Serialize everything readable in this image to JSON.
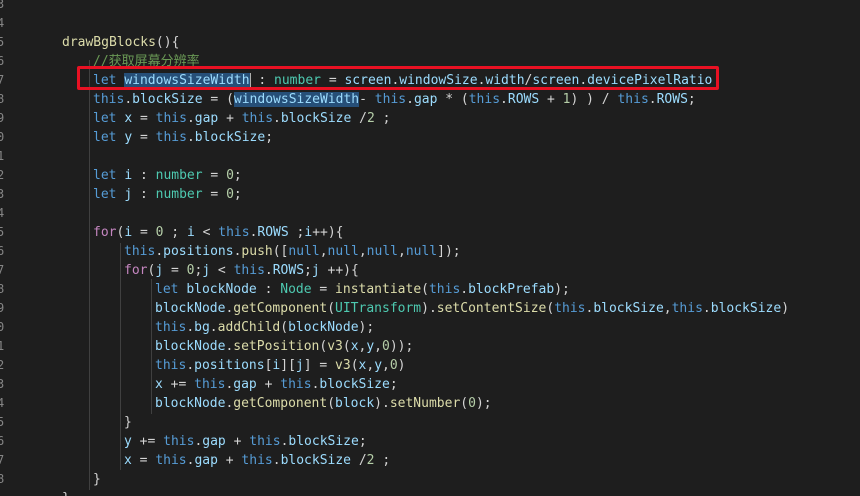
{
  "gutter": {
    "line_numbers": [
      "3",
      "4",
      "5",
      "6",
      "7",
      "8",
      "9",
      "0",
      "1",
      "2",
      "3",
      "4",
      "5",
      "6",
      "7",
      "8",
      "9",
      "0",
      "1",
      "2",
      "3",
      "4",
      "5",
      "6",
      "7",
      "8"
    ]
  },
  "code": {
    "lines": [
      [],
      [],
      [
        {
          "t": "drawBgBlocks",
          "c": "fn"
        },
        {
          "t": "(){",
          "c": "pl"
        }
      ],
      [
        {
          "t": "//获取屏幕分辨率",
          "c": "cm"
        }
      ],
      [
        {
          "t": "let ",
          "c": "kw"
        },
        {
          "t": "windowsSizeWidth",
          "c": "var",
          "sel": true
        },
        {
          "t": " : ",
          "c": "pl"
        },
        {
          "t": "number",
          "c": "type"
        },
        {
          "t": " = ",
          "c": "pl"
        },
        {
          "t": "screen",
          "c": "var"
        },
        {
          "t": ".",
          "c": "pl"
        },
        {
          "t": "windowSize",
          "c": "var"
        },
        {
          "t": ".",
          "c": "pl"
        },
        {
          "t": "width",
          "c": "var"
        },
        {
          "t": "/",
          "c": "pl"
        },
        {
          "t": "screen",
          "c": "var"
        },
        {
          "t": ".",
          "c": "pl"
        },
        {
          "t": "devicePixelRatio",
          "c": "var"
        }
      ],
      [
        {
          "t": "this",
          "c": "kw"
        },
        {
          "t": ".",
          "c": "pl"
        },
        {
          "t": "blockSize",
          "c": "var"
        },
        {
          "t": " = (",
          "c": "pl"
        },
        {
          "t": "windowsSizeWidth",
          "c": "var",
          "sel": true
        },
        {
          "t": "- ",
          "c": "pl"
        },
        {
          "t": "this",
          "c": "kw"
        },
        {
          "t": ".",
          "c": "pl"
        },
        {
          "t": "gap",
          "c": "var"
        },
        {
          "t": " * (",
          "c": "pl"
        },
        {
          "t": "this",
          "c": "kw"
        },
        {
          "t": ".",
          "c": "pl"
        },
        {
          "t": "ROWS",
          "c": "var"
        },
        {
          "t": " + ",
          "c": "pl"
        },
        {
          "t": "1",
          "c": "num"
        },
        {
          "t": ") ) / ",
          "c": "pl"
        },
        {
          "t": "this",
          "c": "kw"
        },
        {
          "t": ".",
          "c": "pl"
        },
        {
          "t": "ROWS",
          "c": "var"
        },
        {
          "t": ";",
          "c": "pl"
        }
      ],
      [
        {
          "t": "let ",
          "c": "kw"
        },
        {
          "t": "x",
          "c": "var"
        },
        {
          "t": " = ",
          "c": "pl"
        },
        {
          "t": "this",
          "c": "kw"
        },
        {
          "t": ".",
          "c": "pl"
        },
        {
          "t": "gap",
          "c": "var"
        },
        {
          "t": " + ",
          "c": "pl"
        },
        {
          "t": "this",
          "c": "kw"
        },
        {
          "t": ".",
          "c": "pl"
        },
        {
          "t": "blockSize",
          "c": "var"
        },
        {
          "t": " /",
          "c": "pl"
        },
        {
          "t": "2",
          "c": "num"
        },
        {
          "t": " ;",
          "c": "pl"
        }
      ],
      [
        {
          "t": "let ",
          "c": "kw"
        },
        {
          "t": "y",
          "c": "var"
        },
        {
          "t": " = ",
          "c": "pl"
        },
        {
          "t": "this",
          "c": "kw"
        },
        {
          "t": ".",
          "c": "pl"
        },
        {
          "t": "blockSize",
          "c": "var"
        },
        {
          "t": ";",
          "c": "pl"
        }
      ],
      [],
      [
        {
          "t": "let ",
          "c": "kw"
        },
        {
          "t": "i",
          "c": "var"
        },
        {
          "t": " : ",
          "c": "pl"
        },
        {
          "t": "number",
          "c": "type"
        },
        {
          "t": " = ",
          "c": "pl"
        },
        {
          "t": "0",
          "c": "num"
        },
        {
          "t": ";",
          "c": "pl"
        }
      ],
      [
        {
          "t": "let ",
          "c": "kw"
        },
        {
          "t": "j",
          "c": "var"
        },
        {
          "t": " : ",
          "c": "pl"
        },
        {
          "t": "number",
          "c": "type"
        },
        {
          "t": " = ",
          "c": "pl"
        },
        {
          "t": "0",
          "c": "num"
        },
        {
          "t": ";",
          "c": "pl"
        }
      ],
      [],
      [
        {
          "t": "for",
          "c": "ctl"
        },
        {
          "t": "(",
          "c": "pl"
        },
        {
          "t": "i",
          "c": "var"
        },
        {
          "t": " = ",
          "c": "pl"
        },
        {
          "t": "0",
          "c": "num"
        },
        {
          "t": " ; ",
          "c": "pl"
        },
        {
          "t": "i",
          "c": "var"
        },
        {
          "t": " < ",
          "c": "pl"
        },
        {
          "t": "this",
          "c": "kw"
        },
        {
          "t": ".",
          "c": "pl"
        },
        {
          "t": "ROWS",
          "c": "var"
        },
        {
          "t": " ;",
          "c": "pl"
        },
        {
          "t": "i",
          "c": "var"
        },
        {
          "t": "++){",
          "c": "pl"
        }
      ],
      [
        {
          "t": "this",
          "c": "kw"
        },
        {
          "t": ".",
          "c": "pl"
        },
        {
          "t": "positions",
          "c": "var"
        },
        {
          "t": ".",
          "c": "pl"
        },
        {
          "t": "push",
          "c": "fn"
        },
        {
          "t": "([",
          "c": "pl"
        },
        {
          "t": "null",
          "c": "kw"
        },
        {
          "t": ",",
          "c": "pl"
        },
        {
          "t": "null",
          "c": "kw"
        },
        {
          "t": ",",
          "c": "pl"
        },
        {
          "t": "null",
          "c": "kw"
        },
        {
          "t": ",",
          "c": "pl"
        },
        {
          "t": "null",
          "c": "kw"
        },
        {
          "t": "]);",
          "c": "pl"
        }
      ],
      [
        {
          "t": "for",
          "c": "ctl"
        },
        {
          "t": "(",
          "c": "pl"
        },
        {
          "t": "j",
          "c": "var"
        },
        {
          "t": " = ",
          "c": "pl"
        },
        {
          "t": "0",
          "c": "num"
        },
        {
          "t": ";",
          "c": "pl"
        },
        {
          "t": "j",
          "c": "var"
        },
        {
          "t": " < ",
          "c": "pl"
        },
        {
          "t": "this",
          "c": "kw"
        },
        {
          "t": ".",
          "c": "pl"
        },
        {
          "t": "ROWS",
          "c": "var"
        },
        {
          "t": ";",
          "c": "pl"
        },
        {
          "t": "j",
          "c": "var"
        },
        {
          "t": " ++){",
          "c": "pl"
        }
      ],
      [
        {
          "t": "let ",
          "c": "kw"
        },
        {
          "t": "blockNode",
          "c": "var"
        },
        {
          "t": " : ",
          "c": "pl"
        },
        {
          "t": "Node",
          "c": "type"
        },
        {
          "t": " = ",
          "c": "pl"
        },
        {
          "t": "instantiate",
          "c": "fn"
        },
        {
          "t": "(",
          "c": "pl"
        },
        {
          "t": "this",
          "c": "kw"
        },
        {
          "t": ".",
          "c": "pl"
        },
        {
          "t": "blockPrefab",
          "c": "var"
        },
        {
          "t": ");",
          "c": "pl"
        }
      ],
      [
        {
          "t": "blockNode",
          "c": "var"
        },
        {
          "t": ".",
          "c": "pl"
        },
        {
          "t": "getComponent",
          "c": "fn"
        },
        {
          "t": "(",
          "c": "pl"
        },
        {
          "t": "UITransform",
          "c": "type"
        },
        {
          "t": ").",
          "c": "pl"
        },
        {
          "t": "setContentSize",
          "c": "fn"
        },
        {
          "t": "(",
          "c": "pl"
        },
        {
          "t": "this",
          "c": "kw"
        },
        {
          "t": ".",
          "c": "pl"
        },
        {
          "t": "blockSize",
          "c": "var"
        },
        {
          "t": ",",
          "c": "pl"
        },
        {
          "t": "this",
          "c": "kw"
        },
        {
          "t": ".",
          "c": "pl"
        },
        {
          "t": "blockSize",
          "c": "var"
        },
        {
          "t": ")",
          "c": "pl"
        }
      ],
      [
        {
          "t": "this",
          "c": "kw"
        },
        {
          "t": ".",
          "c": "pl"
        },
        {
          "t": "bg",
          "c": "var"
        },
        {
          "t": ".",
          "c": "pl"
        },
        {
          "t": "addChild",
          "c": "fn"
        },
        {
          "t": "(",
          "c": "pl"
        },
        {
          "t": "blockNode",
          "c": "var"
        },
        {
          "t": ");",
          "c": "pl"
        }
      ],
      [
        {
          "t": "blockNode",
          "c": "var"
        },
        {
          "t": ".",
          "c": "pl"
        },
        {
          "t": "setPosition",
          "c": "fn"
        },
        {
          "t": "(",
          "c": "pl"
        },
        {
          "t": "v3",
          "c": "fn"
        },
        {
          "t": "(",
          "c": "pl"
        },
        {
          "t": "x",
          "c": "var"
        },
        {
          "t": ",",
          "c": "pl"
        },
        {
          "t": "y",
          "c": "var"
        },
        {
          "t": ",",
          "c": "pl"
        },
        {
          "t": "0",
          "c": "num"
        },
        {
          "t": "));",
          "c": "pl"
        }
      ],
      [
        {
          "t": "this",
          "c": "kw"
        },
        {
          "t": ".",
          "c": "pl"
        },
        {
          "t": "positions",
          "c": "var"
        },
        {
          "t": "[",
          "c": "pl"
        },
        {
          "t": "i",
          "c": "var"
        },
        {
          "t": "][",
          "c": "pl"
        },
        {
          "t": "j",
          "c": "var"
        },
        {
          "t": "] = ",
          "c": "pl"
        },
        {
          "t": "v3",
          "c": "fn"
        },
        {
          "t": "(",
          "c": "pl"
        },
        {
          "t": "x",
          "c": "var"
        },
        {
          "t": ",",
          "c": "pl"
        },
        {
          "t": "y",
          "c": "var"
        },
        {
          "t": ",",
          "c": "pl"
        },
        {
          "t": "0",
          "c": "num"
        },
        {
          "t": ")",
          "c": "pl"
        }
      ],
      [
        {
          "t": "x",
          "c": "var"
        },
        {
          "t": " += ",
          "c": "pl"
        },
        {
          "t": "this",
          "c": "kw"
        },
        {
          "t": ".",
          "c": "pl"
        },
        {
          "t": "gap",
          "c": "var"
        },
        {
          "t": " + ",
          "c": "pl"
        },
        {
          "t": "this",
          "c": "kw"
        },
        {
          "t": ".",
          "c": "pl"
        },
        {
          "t": "blockSize",
          "c": "var"
        },
        {
          "t": ";",
          "c": "pl"
        }
      ],
      [
        {
          "t": "blockNode",
          "c": "var"
        },
        {
          "t": ".",
          "c": "pl"
        },
        {
          "t": "getComponent",
          "c": "fn"
        },
        {
          "t": "(",
          "c": "pl"
        },
        {
          "t": "block",
          "c": "var"
        },
        {
          "t": ").",
          "c": "pl"
        },
        {
          "t": "setNumber",
          "c": "fn"
        },
        {
          "t": "(",
          "c": "pl"
        },
        {
          "t": "0",
          "c": "num"
        },
        {
          "t": ");",
          "c": "pl"
        }
      ],
      [
        {
          "t": "}",
          "c": "pl"
        }
      ],
      [
        {
          "t": "y",
          "c": "var"
        },
        {
          "t": " += ",
          "c": "pl"
        },
        {
          "t": "this",
          "c": "kw"
        },
        {
          "t": ".",
          "c": "pl"
        },
        {
          "t": "gap",
          "c": "var"
        },
        {
          "t": " + ",
          "c": "pl"
        },
        {
          "t": "this",
          "c": "kw"
        },
        {
          "t": ".",
          "c": "pl"
        },
        {
          "t": "blockSize",
          "c": "var"
        },
        {
          "t": ";",
          "c": "pl"
        }
      ],
      [
        {
          "t": "x",
          "c": "var"
        },
        {
          "t": " = ",
          "c": "pl"
        },
        {
          "t": "this",
          "c": "kw"
        },
        {
          "t": ".",
          "c": "pl"
        },
        {
          "t": "gap",
          "c": "var"
        },
        {
          "t": " + ",
          "c": "pl"
        },
        {
          "t": "this",
          "c": "kw"
        },
        {
          "t": ".",
          "c": "pl"
        },
        {
          "t": "blockSize",
          "c": "var"
        },
        {
          "t": " /",
          "c": "pl"
        },
        {
          "t": "2",
          "c": "num"
        },
        {
          "t": " ;",
          "c": "pl"
        }
      ],
      [
        {
          "t": "}",
          "c": "pl"
        }
      ]
    ],
    "last_line": [
      {
        "t": "}",
        "c": "pl"
      }
    ]
  },
  "colors": {
    "background": "#1e1e1e",
    "keyword": "#569cd6",
    "control": "#c586c0",
    "function": "#dcdcaa",
    "variable": "#9cdcfe",
    "number": "#b5cea8",
    "type": "#4ec9b0",
    "comment": "#6a9955",
    "selection": "#264f78",
    "highlight_box": "#e81123"
  }
}
